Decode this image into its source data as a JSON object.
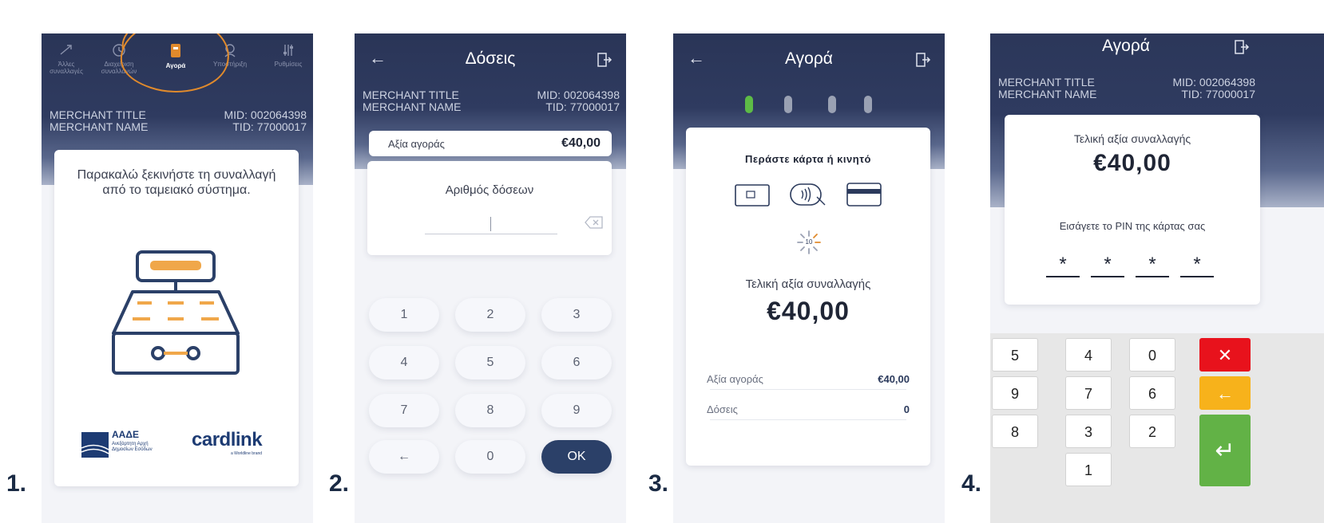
{
  "steps": [
    "1.",
    "2.",
    "3.",
    "4."
  ],
  "merchant": {
    "title": "MERCHANT TITLE",
    "name": "MERCHANT NAME",
    "mid": "MID: 002064398",
    "tid": "TID: 77000017"
  },
  "screen1": {
    "nav": [
      {
        "label": "Άλλες συναλλαγές",
        "icon": "transfer-icon"
      },
      {
        "label": "Διαχείριση συναλλαγών",
        "icon": "clock-icon"
      },
      {
        "label": "Αγορά",
        "icon": "card-hand-icon"
      },
      {
        "label": "Υποστήριξη",
        "icon": "support-icon"
      },
      {
        "label": "Ρυθμίσεις",
        "icon": "sliders-icon"
      }
    ],
    "message": "Παρακαλώ ξεκινήστε τη συναλλαγή από το ταμειακό σύστημα.",
    "aade_title": "ΑΑΔΕ",
    "aade_sub": "Ανεξάρτητη Αρχή Δημοσίων Εσόδων",
    "brand": "cardlink",
    "brand_sub": "a Worldline brand"
  },
  "screen2": {
    "title": "Δόσεις",
    "amount_label": "Αξία αγοράς",
    "amount_value": "€40,00",
    "installments_label": "Αριθμός δόσεων",
    "keys": [
      "1",
      "2",
      "3",
      "4",
      "5",
      "6",
      "7",
      "8",
      "9",
      "←",
      "0",
      "OK"
    ]
  },
  "screen3": {
    "title": "Αγορά",
    "prompt": "Περάστε κάρτα ή κινητό",
    "countdown": "10",
    "final_label": "Τελική αξία συναλλαγής",
    "final_value": "€40,00",
    "amount_label": "Αξία αγοράς",
    "amount_value": "€40,00",
    "installments_label": "Δόσεις",
    "installments_value": "0"
  },
  "screen4": {
    "title": "Αγορά",
    "final_label": "Τελική αξία συναλλαγής",
    "final_value": "€40,00",
    "pin_label": "Εισάγετε το PIN της κάρτας σας",
    "pin_digits": [
      "*",
      "*",
      "*",
      "*"
    ],
    "keys": [
      "5",
      "4",
      "0",
      "9",
      "7",
      "6",
      "8",
      "3",
      "2",
      "1"
    ],
    "cancel_symbol": "✕",
    "clear_symbol": "←",
    "enter_symbol": "↵",
    "colors": {
      "cancel": "#e8121c",
      "clear": "#f7b21b",
      "enter": "#62b246"
    }
  }
}
